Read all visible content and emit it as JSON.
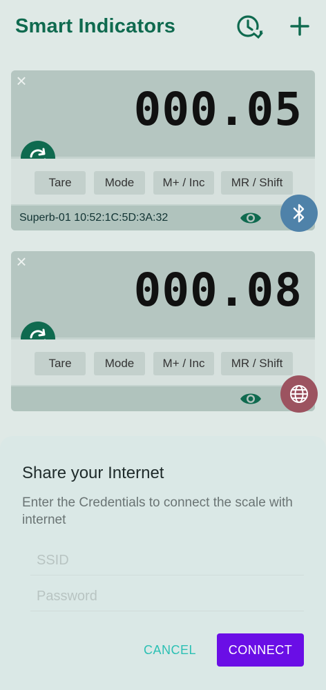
{
  "header": {
    "title": "Smart Indicators",
    "history_icon": "history-clock-icon",
    "add_icon": "plus-icon"
  },
  "cards": [
    {
      "reading": "000.05",
      "buttons": [
        "Tare",
        "Mode",
        "M+ / Inc",
        "MR / Shift"
      ],
      "device_label": "Superb-01 10:52:1C:5D:3A:32",
      "connection_icon": "bluetooth-icon"
    },
    {
      "reading": "000.08",
      "buttons": [
        "Tare",
        "Mode",
        "M+ / Inc",
        "MR / Shift"
      ],
      "device_label": "",
      "connection_icon": "globe-icon"
    }
  ],
  "dialog": {
    "title": "Share your Internet",
    "message": "Enter the Credentials to connect the scale with internet",
    "ssid_placeholder": "SSID",
    "password_placeholder": "Password",
    "cancel_label": "CANCEL",
    "connect_label": "CONNECT"
  },
  "colors": {
    "brand": "#0f6a4f",
    "accent": "#6a0ee6",
    "cancel": "#2bc0b4"
  }
}
